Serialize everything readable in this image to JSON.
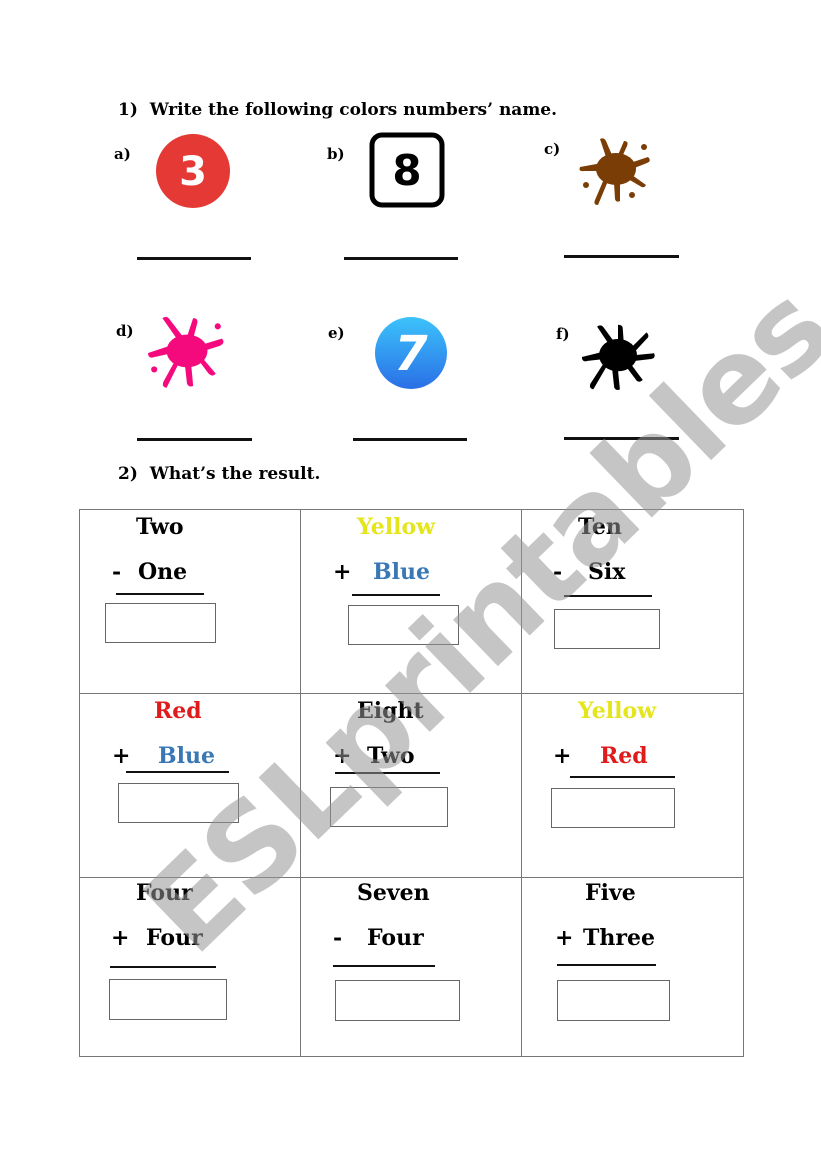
{
  "section1": {
    "number": "1)",
    "title": "Write the following colors numbers’ name.",
    "items": [
      {
        "label": "a)",
        "icon": "number-3-red-circle",
        "glyph": "3",
        "color": "#e53935"
      },
      {
        "label": "b)",
        "icon": "number-8-square",
        "glyph": "8",
        "color": "#000000"
      },
      {
        "label": "c)",
        "icon": "brown-paint-splash",
        "color": "#7b3d06"
      },
      {
        "label": "d)",
        "icon": "pink-paint-splash",
        "color": "#f50a7d"
      },
      {
        "label": "e)",
        "icon": "number-7-blue-circle",
        "glyph": "7",
        "color": "#2f8ff0"
      },
      {
        "label": "f)",
        "icon": "black-paint-splash",
        "color": "#000000"
      }
    ]
  },
  "section2": {
    "number": "2)",
    "title": "What’s the result.",
    "problems": [
      {
        "top": "Two",
        "top_color": "#000000",
        "op": "-",
        "bottom": "One",
        "bottom_color": "#000000"
      },
      {
        "top": "Yellow",
        "top_color": "#e5e51c",
        "op": "+",
        "bottom": "Blue",
        "bottom_color": "#3a78b5"
      },
      {
        "top": "Ten",
        "top_color": "#000000",
        "op": "-",
        "bottom": "Six",
        "bottom_color": "#000000"
      },
      {
        "top": "Red",
        "top_color": "#e01b1b",
        "op": "+",
        "bottom": "Blue",
        "bottom_color": "#3a78b5"
      },
      {
        "top": "Eight",
        "top_color": "#000000",
        "op": "+",
        "bottom": "Two",
        "bottom_color": "#000000"
      },
      {
        "top": "Yellow",
        "top_color": "#e5e51c",
        "op": "+",
        "bottom": "Red",
        "bottom_color": "#e01b1b"
      },
      {
        "top": "Four",
        "top_color": "#000000",
        "op": "+",
        "bottom": "Four",
        "bottom_color": "#000000"
      },
      {
        "top": "Seven",
        "top_color": "#000000",
        "op": "-",
        "bottom": "Four",
        "bottom_color": "#000000"
      },
      {
        "top": "Five",
        "top_color": "#000000",
        "op": "+",
        "bottom": "Three",
        "bottom_color": "#000000"
      }
    ]
  },
  "watermark": "ESLprintables.com"
}
